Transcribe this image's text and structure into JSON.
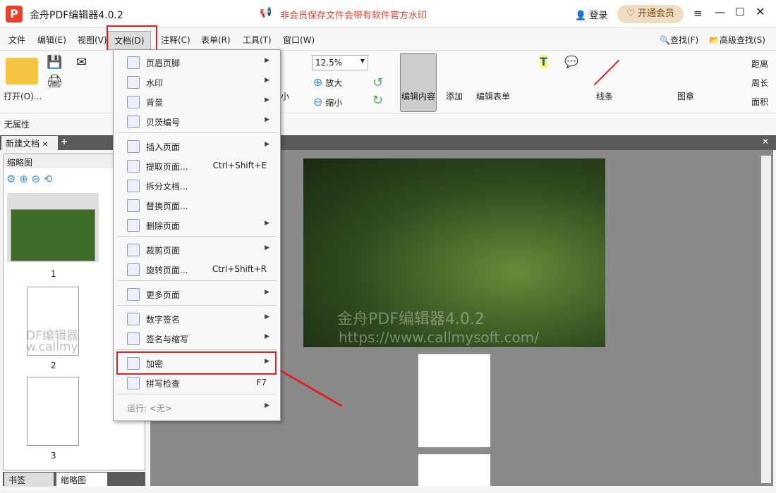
{
  "app": {
    "title": "金舟PDF编辑器4.0.2",
    "notice": "非会员保存文件会带有软件官方水印",
    "login": "登录",
    "vip": "开通会员",
    "logo": "P"
  },
  "menubar": [
    "文件",
    "编辑(E)",
    "视图(V)",
    "文档(D)",
    "注释(C)",
    "表单(R)",
    "工具(T)",
    "窗口(W)"
  ],
  "ribbon": {
    "open": "打开(O)...",
    "zoom": "12.5%",
    "zoom_in": "放大",
    "zoom_out": "缩小",
    "small": "小",
    "edit_content": "编辑内容",
    "add": "添加",
    "edit_form": "编辑表单",
    "lines": "线条",
    "stamp": "图章",
    "distance": "距离",
    "perimeter": "周长",
    "area": "面积",
    "find": "查找(F)",
    "adv_find": "高级查找(S)"
  },
  "propbar": "无属性",
  "tabs": {
    "doc": "新建文档",
    "thumbs_header": "缩略图",
    "bottom": [
      "书签",
      "缩略图"
    ]
  },
  "thumbs": [
    "1",
    "2",
    "3"
  ],
  "watermark": {
    "line1": "金舟PDF编辑器4.0.2",
    "line2": "https://www.callmysoft.com/",
    "short1": "DF编辑器",
    "short2": "w.callmy"
  },
  "doc_menu": {
    "items": [
      {
        "label": "页眉页脚",
        "arrow": true
      },
      {
        "label": "水印",
        "arrow": true
      },
      {
        "label": "背景",
        "arrow": true
      },
      {
        "label": "贝茨编号",
        "arrow": true
      },
      {
        "label": "插入页面",
        "arrow": true
      },
      {
        "label": "提取页面...",
        "shortcut": "Ctrl+Shift+E"
      },
      {
        "label": "拆分文档..."
      },
      {
        "label": "替换页面..."
      },
      {
        "label": "删除页面",
        "arrow": true
      },
      {
        "label": "裁剪页面",
        "arrow": true
      },
      {
        "label": "旋转页面...",
        "shortcut": "Ctrl+Shift+R"
      },
      {
        "label": "更多页面",
        "arrow": true
      },
      {
        "label": "数字签名",
        "arrow": true
      },
      {
        "label": "签名与缩写",
        "arrow": true
      },
      {
        "label": "加密",
        "arrow": true
      },
      {
        "label": "拼写检查",
        "shortcut": "F7"
      },
      {
        "label": "运行: <无>",
        "arrow": true
      }
    ]
  },
  "colors": {
    "highlight": "#d22222",
    "accent": "#e8412b"
  }
}
